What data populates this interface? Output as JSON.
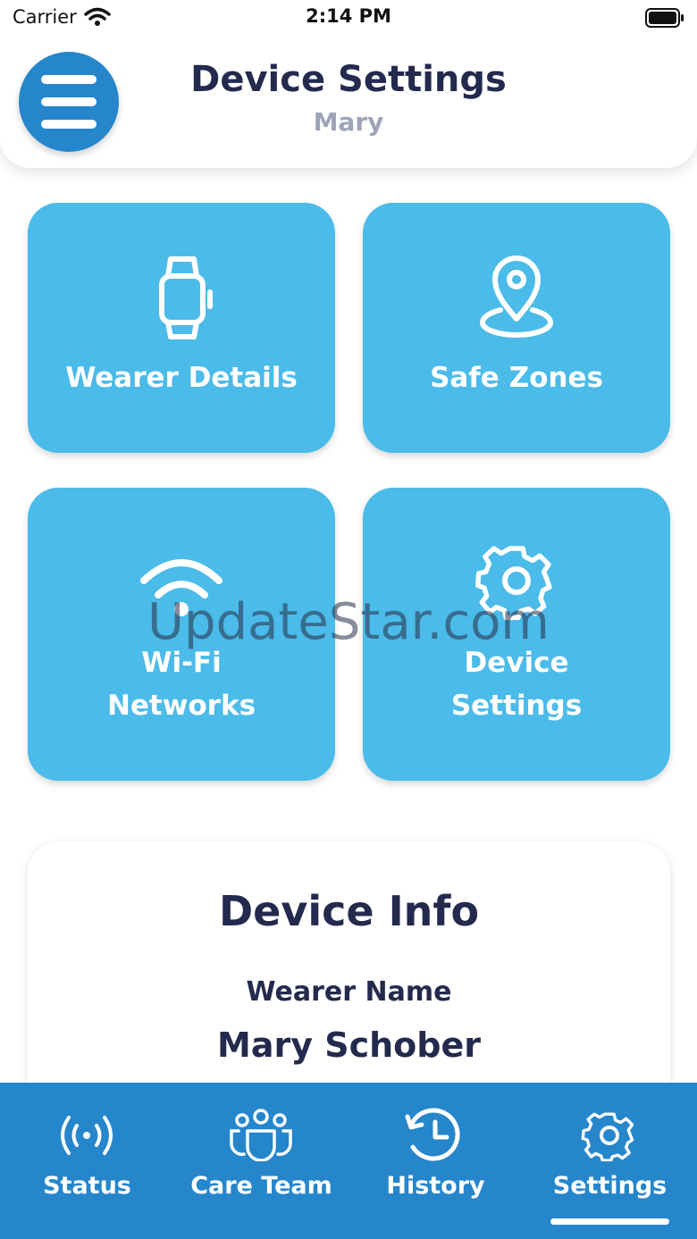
{
  "status_bar": {
    "carrier": "Carrier",
    "time": "2:14 PM"
  },
  "header": {
    "title": "Device Settings",
    "subtitle": "Mary"
  },
  "tiles": [
    {
      "label": "Wearer Details",
      "icon": "watch-icon"
    },
    {
      "label": "Safe Zones",
      "icon": "location-pin-icon"
    },
    {
      "label_line1": "Wi-Fi",
      "label_line2": "Networks",
      "icon": "wifi-icon"
    },
    {
      "label_line1": "Device",
      "label_line2": "Settings",
      "icon": "gear-icon"
    }
  ],
  "watermark": "UpdateStar.com",
  "device_info": {
    "title": "Device Info",
    "wearer_label": "Wearer Name",
    "wearer_name": "Mary Schober"
  },
  "tabs": [
    {
      "label": "Status",
      "icon": "broadcast-icon"
    },
    {
      "label": "Care Team",
      "icon": "team-icon"
    },
    {
      "label": "History",
      "icon": "history-icon"
    },
    {
      "label": "Settings",
      "icon": "gear-icon",
      "active": true
    }
  ],
  "colors": {
    "primary": "#2586cc",
    "tile": "#4bbbe9",
    "text_dark": "#232a4d",
    "text_muted": "#9ea3b8"
  }
}
